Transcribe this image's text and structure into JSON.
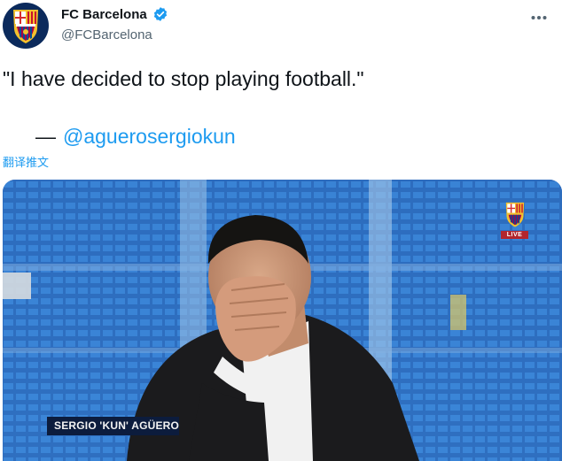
{
  "account": {
    "display_name": "FC Barcelona",
    "handle": "@FCBarcelona",
    "verified_icon": "verified-badge-icon",
    "avatar_icon": "fc-barcelona-crest-icon",
    "more_icon": "more-options-icon"
  },
  "tweet": {
    "quote": "\"I have decided to stop playing football.\"",
    "dash": "—",
    "mention": "@aguerosergiokun",
    "translate_label": "翻译推文"
  },
  "media": {
    "live_label": "LIVE",
    "caption": "SERGIO 'KUN' AGÜERO",
    "colors": {
      "stadium_blue": "#2f74c7",
      "suit": "#1b1b1d",
      "caption_bg": "#0c1c3d",
      "caption_accent": "#b3262d"
    }
  },
  "colors": {
    "link": "#1d9bf0",
    "text": "#0f1419",
    "secondary": "#536471"
  }
}
